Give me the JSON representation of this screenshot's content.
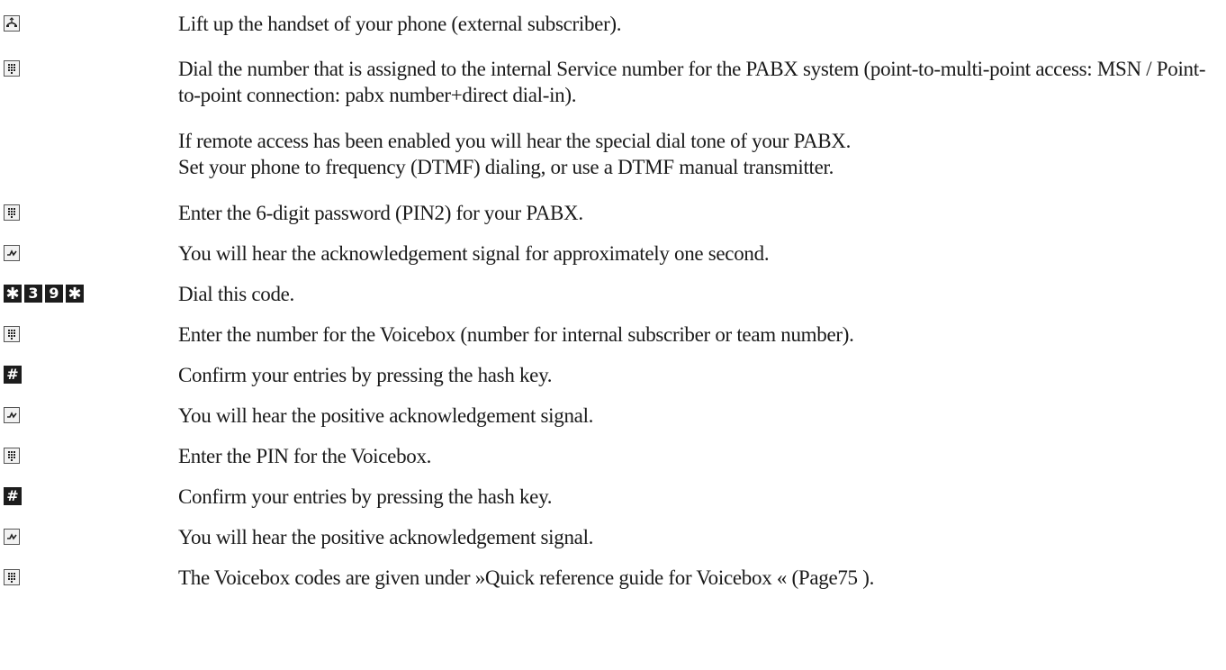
{
  "steps": [
    {
      "icon": "handset-icon",
      "text": "Lift up the handset of your phone (external subscriber)."
    },
    {
      "icon": "keypad-icon",
      "text": "Dial the number that is assigned to the internal Service number for the PABX system (point-to-multi-point access: MSN / Point-to-point connection: pabx number+direct dial-in)."
    },
    {
      "icon": "",
      "line1": "If remote access has been enabled you will hear the special dial tone of your PABX.",
      "line2": "Set your phone to frequency (DTMF) dialing, or use a DTMF manual transmitter."
    },
    {
      "icon": "keypad-icon",
      "text": "Enter the 6-digit password (PIN2) for your PABX."
    },
    {
      "icon": "acknowledgement-signal-icon",
      "text": "You will hear the acknowledgement signal for approximately one second."
    },
    {
      "icon": "code-keys",
      "keys": [
        "✱",
        "3",
        "9",
        "✱"
      ],
      "text": "Dial this code."
    },
    {
      "icon": "keypad-icon",
      "text": "Enter the number for the Voicebox (number for internal subscriber or team number)."
    },
    {
      "icon": "hash-key-icon",
      "key": "#",
      "text": "Confirm your entries by pressing the hash key."
    },
    {
      "icon": "acknowledgement-signal-icon",
      "text": "You will hear the positive acknowledgement signal."
    },
    {
      "icon": "keypad-icon",
      "text": "Enter the PIN for the Voicebox."
    },
    {
      "icon": "hash-key-icon",
      "key": "#",
      "text": "Confirm your entries by pressing the hash key."
    },
    {
      "icon": "acknowledgement-signal-icon",
      "text": "You will hear the positive acknowledgement signal."
    },
    {
      "icon": "keypad-icon",
      "text": "The Voicebox codes are given under »Quick reference guide for Voicebox « (Page75 )."
    }
  ]
}
